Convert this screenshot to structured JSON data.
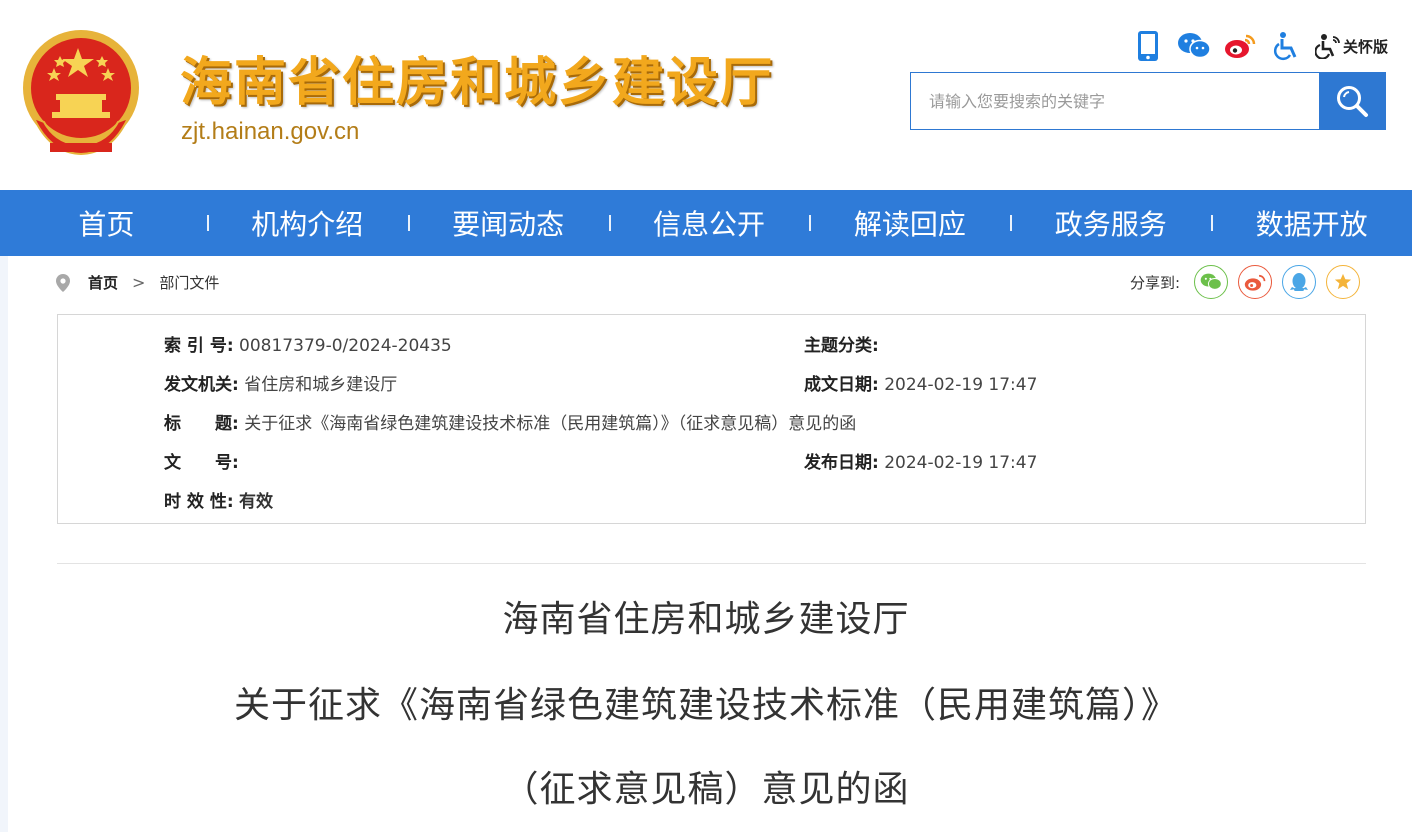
{
  "header": {
    "site_title": "海南省住房和城乡建设厅",
    "site_domain": "zjt.hainan.gov.cn",
    "care_label": "关怀版",
    "icons": [
      "mobile-icon",
      "wechat-icon",
      "weibo-icon",
      "accessibility-icon",
      "elder-care-icon"
    ],
    "search_placeholder": "请输入您要搜索的关键字"
  },
  "nav": {
    "items": [
      "首页",
      "机构介绍",
      "要闻动态",
      "信息公开",
      "解读回应",
      "政务服务",
      "数据开放"
    ]
  },
  "breadcrumb": {
    "home": "首页",
    "separator": ">",
    "current": "部门文件"
  },
  "share": {
    "label": "分享到:",
    "targets": [
      "wechat",
      "weibo",
      "qq",
      "favorite"
    ]
  },
  "info": {
    "index_no_label": "索 引 号:",
    "index_no": "00817379-0/2024-20435",
    "topic_label": "主题分类:",
    "topic": "",
    "issuer_label": "发文机关:",
    "issuer": "省住房和城乡建设厅",
    "made_date_label": "成文日期:",
    "made_date": "2024-02-19 17:47",
    "title_label": "标　　题:",
    "title": "关于征求《海南省绿色建筑建设技术标准（民用建筑篇）》（征求意见稿）意见的函",
    "doc_no_label": "文　　号:",
    "doc_no": "",
    "publish_date_label": "发布日期:",
    "publish_date": "2024-02-19 17:47",
    "validity_label": "时 效 性:",
    "validity": "有效"
  },
  "document": {
    "title_line1": "海南省住房和城乡建设厅",
    "title_line2": "关于征求《海南省绿色建筑建设技术标准（民用建筑篇）》",
    "title_line3": "（征求意见稿）意见的函"
  },
  "colors": {
    "brand_blue": "#2f7bd8",
    "title_gold": "#f2a81d",
    "emblem_red": "#d9261c"
  }
}
